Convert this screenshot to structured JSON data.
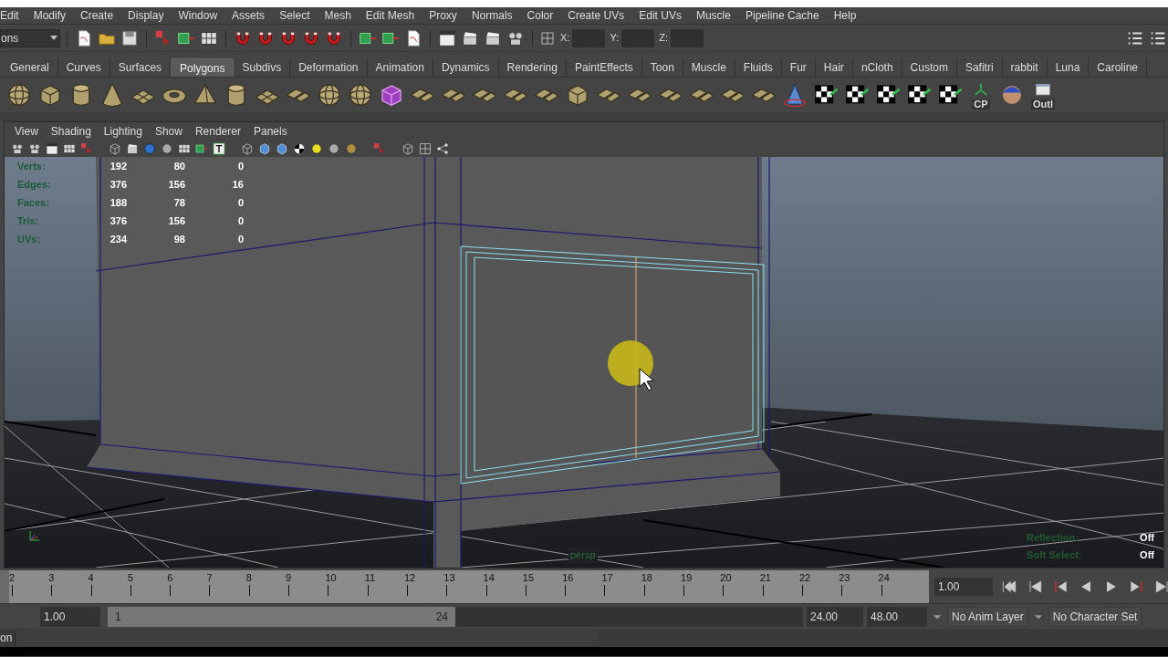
{
  "menu_bar": [
    "Edit",
    "Modify",
    "Create",
    "Display",
    "Window",
    "Assets",
    "Select",
    "Mesh",
    "Edit Mesh",
    "Proxy",
    "Normals",
    "Color",
    "Create UVs",
    "Edit UVs",
    "Muscle",
    "Pipeline Cache",
    "Help"
  ],
  "status_line": {
    "mode_dropdown": "ons",
    "coordinate_fields": [
      {
        "label": "X:"
      },
      {
        "label": "Y:"
      },
      {
        "label": "Z:"
      }
    ]
  },
  "shelf_tabs": [
    {
      "label": "General",
      "selected": false
    },
    {
      "label": "Curves",
      "selected": false
    },
    {
      "label": "Surfaces",
      "selected": false
    },
    {
      "label": "Polygons",
      "selected": true
    },
    {
      "label": "Subdivs",
      "selected": false
    },
    {
      "label": "Deformation",
      "selected": false
    },
    {
      "label": "Animation",
      "selected": false
    },
    {
      "label": "Dynamics",
      "selected": false
    },
    {
      "label": "Rendering",
      "selected": false
    },
    {
      "label": "PaintEffects",
      "selected": false
    },
    {
      "label": "Toon",
      "selected": false
    },
    {
      "label": "Muscle",
      "selected": false
    },
    {
      "label": "Fluids",
      "selected": false
    },
    {
      "label": "Fur",
      "selected": false
    },
    {
      "label": "Hair",
      "selected": false
    },
    {
      "label": "nCloth",
      "selected": false
    },
    {
      "label": "Custom",
      "selected": false
    },
    {
      "label": "Safitri",
      "selected": false
    },
    {
      "label": "rabbit",
      "selected": false
    },
    {
      "label": "Luna",
      "selected": false
    },
    {
      "label": "Caroline",
      "selected": false
    }
  ],
  "shelf_labels": [
    "CP",
    "Outl"
  ],
  "panel_menu": [
    "View",
    "Shading",
    "Lighting",
    "Show",
    "Renderer",
    "Panels"
  ],
  "hud_stats": [
    {
      "label": "Verts:",
      "values": [
        "192",
        "80",
        "0"
      ]
    },
    {
      "label": "Edges:",
      "values": [
        "376",
        "156",
        "16"
      ]
    },
    {
      "label": "Faces:",
      "values": [
        "188",
        "78",
        "0"
      ]
    },
    {
      "label": "Tris:",
      "values": [
        "376",
        "156",
        "0"
      ]
    },
    {
      "label": "UVs:",
      "values": [
        "234",
        "98",
        "0"
      ]
    }
  ],
  "hud_right": [
    {
      "label": "Reflection:",
      "value": "Off"
    },
    {
      "label": "Soft Select:",
      "value": "Off"
    }
  ],
  "camera_label": "persp",
  "time_slider": {
    "frames": [
      "2",
      "3",
      "4",
      "5",
      "6",
      "7",
      "8",
      "9",
      "10",
      "11",
      "12",
      "13",
      "14",
      "15",
      "16",
      "17",
      "18",
      "19",
      "20",
      "21",
      "22",
      "23",
      "24"
    ],
    "current_time": "1.00",
    "level": 0
  },
  "range_slider": {
    "start_time": "1.00",
    "range_start": "1",
    "range_end": "24",
    "level": 0.5,
    "end_time": "24.00",
    "max_time": "48.00",
    "anim_layer": "No Anim Layer",
    "character_set": "No Character Set"
  },
  "command_line": {
    "label": "on"
  }
}
